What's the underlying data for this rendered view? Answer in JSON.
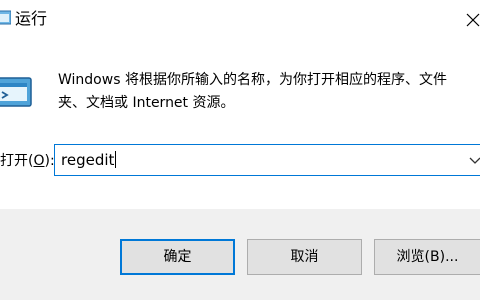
{
  "window": {
    "title": "运行",
    "icon": "run-icon",
    "close_icon": "close-icon"
  },
  "description": "Windows 将根据你所输入的名称，为你打开相应的程序、文件夹、文档或 Internet 资源。",
  "open_field": {
    "label_prefix": "打开(",
    "label_hotkey": "O",
    "label_suffix": "):",
    "value": "regedit",
    "dropdown_icon": "chevron-down-icon"
  },
  "buttons": {
    "ok": "确定",
    "cancel": "取消",
    "browse": "浏览(B)..."
  },
  "colors": {
    "accent": "#0078d7",
    "button_bg": "#e1e1e1",
    "dialog_bg": "#f0f0f0"
  }
}
